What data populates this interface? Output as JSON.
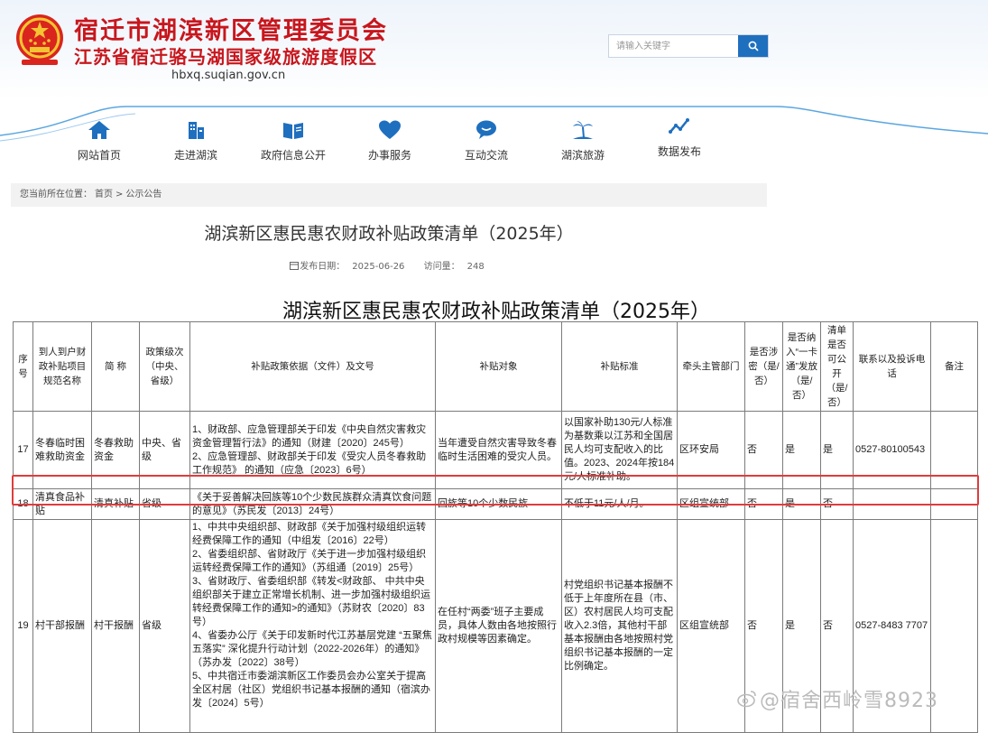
{
  "header": {
    "title": "宿迁市湖滨新区管理委员会",
    "subtitle": "江苏省宿迁骆马湖国家级旅游度假区",
    "url": "hbxq.suqian.gov.cn"
  },
  "search": {
    "placeholder": "请输入关键字",
    "icon": "search-icon"
  },
  "nav": [
    {
      "label": "网站首页",
      "icon": "home-icon"
    },
    {
      "label": "走进湖滨",
      "icon": "building-icon"
    },
    {
      "label": "政府信息公开",
      "icon": "book-icon"
    },
    {
      "label": "办事服务",
      "icon": "heart-icon"
    },
    {
      "label": "互动交流",
      "icon": "chat-icon"
    },
    {
      "label": "湖滨旅游",
      "icon": "palm-icon"
    },
    {
      "label": "数据发布",
      "icon": "chart-icon"
    }
  ],
  "breadcrumb": {
    "prefix": "您当前所在位置：",
    "home": "首页",
    "sep": ">",
    "current": "公示公告"
  },
  "article": {
    "title": "湖滨新区惠民惠农财政补贴政策清单（2025年）",
    "date_label": "发布日期：",
    "date": "2025-06-26",
    "views_label": "访问量：",
    "views": "248"
  },
  "doc_title": "湖滨新区惠民惠农财政补贴政策清单（2025年）",
  "table": {
    "headers": [
      "序号",
      "到人到户财政补贴项目规范名称",
      "简 称",
      "政策级次（中央、省级）",
      "补贴政策依据（文件）及文号",
      "补贴对象",
      "补贴标准",
      "牵头主管部门",
      "是否涉密（是/否）",
      "是否纳入“一卡通”发放（是/否）",
      "清单是否可公开（是/否）",
      "联系以及投诉电话",
      "备注"
    ],
    "rows": [
      {
        "no": "17",
        "name": "冬春临时困难救助资金",
        "short": "冬春救助资金",
        "level": "中央、省级",
        "basis": [
          "1、财政部、应急管理部关于印发《中央自然灾害救灾资金管理暂行法》的通知（财建〔2020〕245号）",
          "2、应急管理部、财政部关于印发《受灾人员冬春救助工作规范》 的通知（应急〔2023〕6号）"
        ],
        "target": "当年遭受自然灾害导致冬春临时生活困难的受灾人员。",
        "standard": "以国家补助130元/人标准为基数乘以江苏和全国居民人均可支配收入的比值。2023、2024年按184元/人标准补助。",
        "dept": "区环安局",
        "secret": "否",
        "card": "是",
        "public": "是",
        "phone": "0527-80100543",
        "remark": ""
      },
      {
        "no": "18",
        "name": "清真食品补贴",
        "short": "清真补贴",
        "level": "省级",
        "basis": [
          "《关于妥善解决回族等10个少数民族群众清真饮食问题的意见》（苏民发〔2013〕24号）"
        ],
        "target": "回族等10个少数民族",
        "standard": "不低于11元/人/月。",
        "dept": "区组宣统部",
        "secret": "否",
        "card": "是",
        "public": "否",
        "phone": "",
        "remark": ""
      },
      {
        "no": "19",
        "name": "村干部报酬",
        "short": "村干报酬",
        "level": "省级",
        "basis": [
          "1、中共中央组织部、财政部《关于加强村级组织运转经费保障工作的通知（中组发〔2016〕22号）",
          "2、省委组织部、省财政厅《关于进一步加强村级组织运转经费保障工作的通知》（苏组通〔2019〕25号）",
          "3、省财政厅、省委组织部《转发<财政部、 中共中央组织部关于建立正常增长机制、进一步加强村级组织运转经费保障工作的通知>的通知》（苏财农〔2020〕83号）",
          "4、省委办公厅《关于印发新时代江苏基层党建 “五聚焦五落实” 深化提升行动计划（2022-2026年）的通知》（苏办发〔2022〕38号）",
          "5、中共宿迁市委湖滨新区工作委员会办公室关于提高全区村居（社区）党组织书记基本报酬的通知（宿滨办发〔2024〕5号）"
        ],
        "target": "在任村“两委”班子主要成员，具体人数由各地按照行政村规模等因素确定。",
        "standard": "村党组织书记基本报酬不低于上年度所在县（市、区）农村居民人均可支配收入2.3倍，其他村干部基本报酬由各地按照村党组织书记基本报酬的一定比例确定。",
        "dept": "区组宣统部",
        "secret": "否",
        "card": "是",
        "public": "否",
        "phone": "0527-8483 7707",
        "remark": ""
      }
    ]
  },
  "watermark": "@宿舍西岭雪8923",
  "colors": {
    "brand_red": "#c8161d",
    "nav_blue": "#1f6fbf",
    "highlight": "#e03c3c"
  }
}
